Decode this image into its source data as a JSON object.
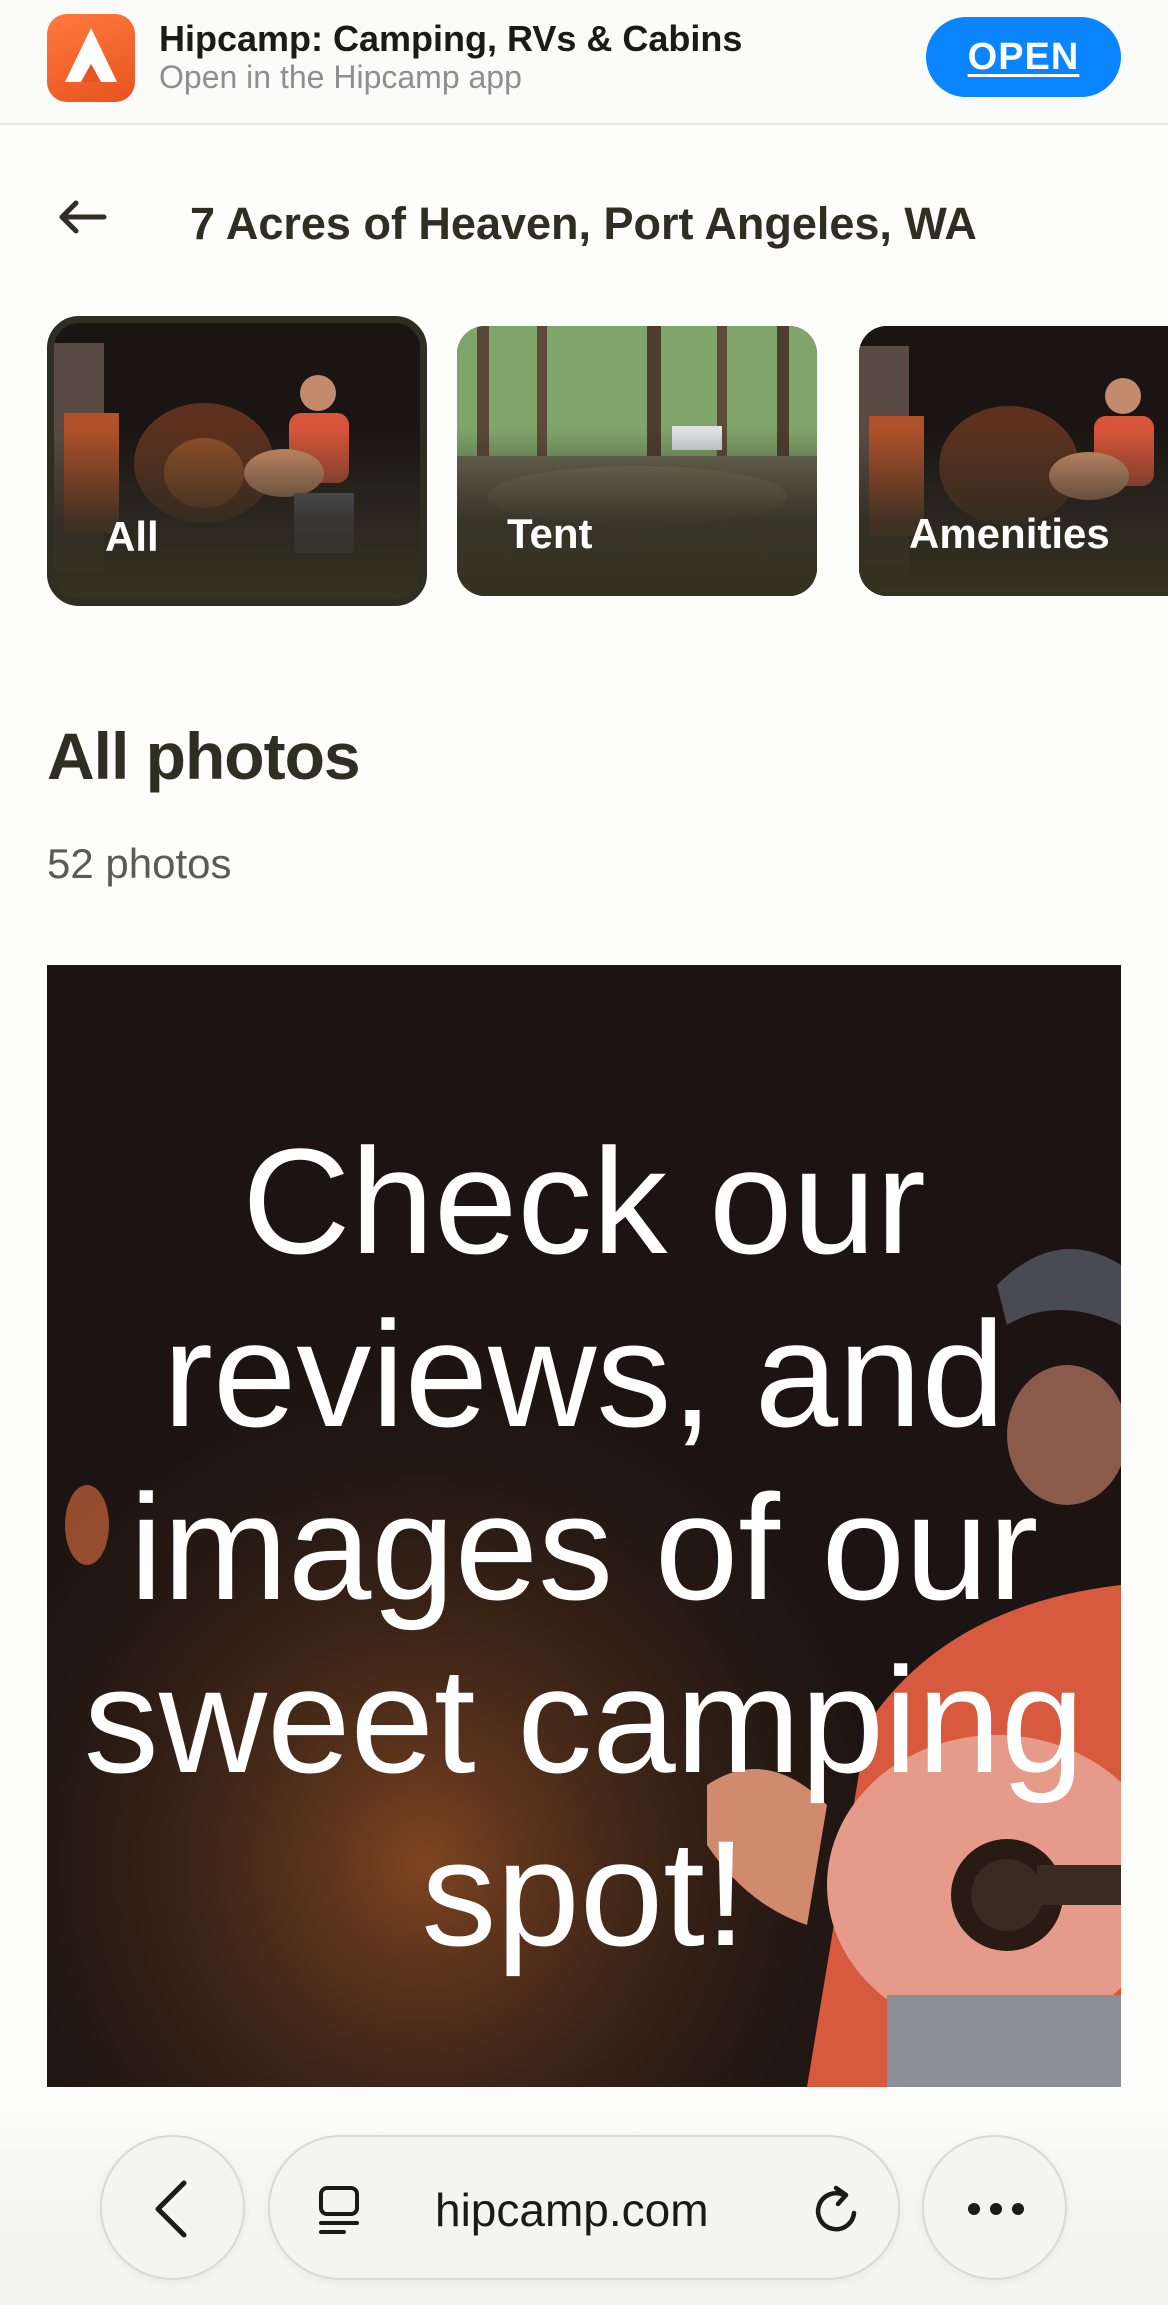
{
  "app_banner": {
    "title": "Hipcamp: Camping, RVs & Cabins",
    "subtitle": "Open in the Hipcamp app",
    "open_label": "OPEN",
    "icon": "hipcamp-tent-icon"
  },
  "header": {
    "back_icon": "back-arrow-icon",
    "title": "7 Acres of Heaven, Port Angeles, WA"
  },
  "categories": [
    {
      "label": "All",
      "selected": true
    },
    {
      "label": "Tent",
      "selected": false
    },
    {
      "label": "Amenities",
      "selected": false
    }
  ],
  "section": {
    "title": "All photos",
    "count": "52 photos"
  },
  "photo": {
    "caption_lines": [
      "Check our",
      "reviews, and",
      "images of our",
      "sweet camping",
      "spot!"
    ]
  },
  "browser": {
    "back_icon": "chevron-left-icon",
    "tabs_icon": "page-menu-icon",
    "url": "hipcamp.com",
    "reload_icon": "reload-icon",
    "more_icon": "more-icon"
  },
  "colors": {
    "accent_blue": "#0a84ff",
    "brand_orange": "#f15a24",
    "text_dark": "#2e2e22"
  }
}
